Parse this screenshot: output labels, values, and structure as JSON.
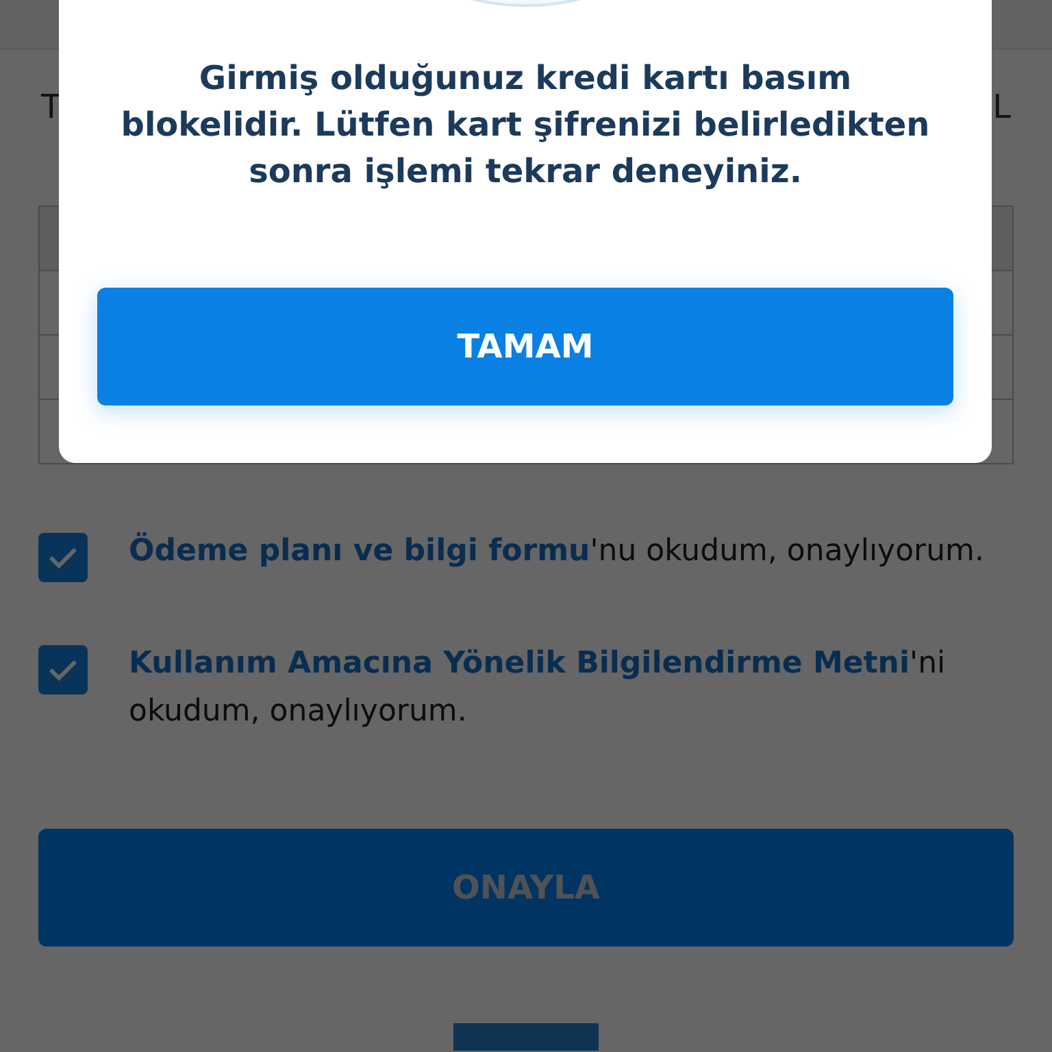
{
  "page": {
    "row_label": "T",
    "row_value": "L"
  },
  "consents": [
    {
      "link": "Ödeme planı ve bilgi formu",
      "text": "'nu okudum, onaylıyorum.",
      "checked": true
    },
    {
      "link": "Kullanım Amacına Yönelik Bilgilendirme Metni",
      "text": "'ni okudum, onaylıyorum.",
      "checked": true
    }
  ],
  "confirm_button": {
    "label": "ONAYLA",
    "disabled": true
  },
  "dialog": {
    "message": "Girmiş olduğunuz kredi kartı basım blokelidir. Lütfen kart şifrenizi belirledikten sonra işlemi tekrar deneyiniz.",
    "button": "TAMAM"
  }
}
